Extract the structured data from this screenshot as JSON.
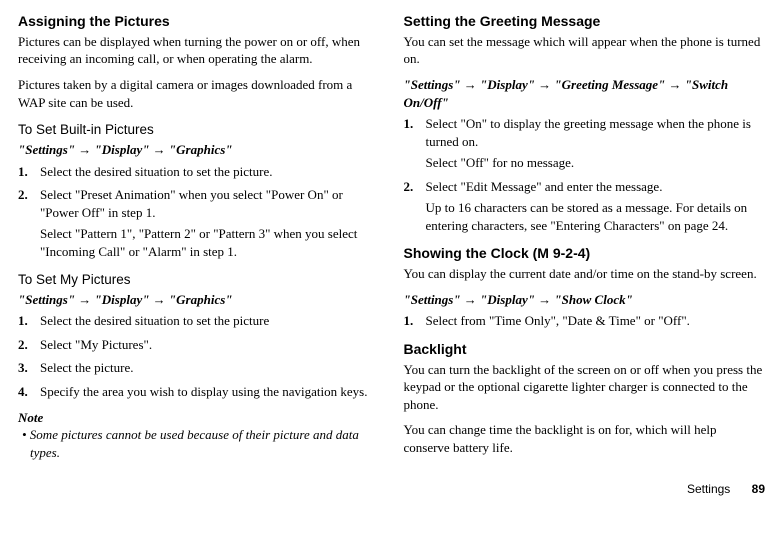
{
  "left": {
    "h1": "Assigning the Pictures",
    "p1": "Pictures can be displayed when turning the power on or off, when receiving an incoming call, or when operating the alarm.",
    "p2": "Pictures taken by a digital camera or images downloaded from a WAP site can be used.",
    "sub1": "To Set Built-in Pictures",
    "path1": "\"Settings\" → \"Display\" → \"Graphics\"",
    "s1_1": "Select the desired situation to set the picture.",
    "s1_2": "Select \"Preset Animation\" when you select \"Power On\" or \"Power Off\" in step 1.",
    "s1_2b": "Select \"Pattern 1\", \"Pattern 2\" or \"Pattern 3\" when you select \"Incoming Call\" or \"Alarm\" in step 1.",
    "sub2": "To Set My Pictures",
    "path2": "\"Settings\" → \"Display\" → \"Graphics\"",
    "s2_1": "Select the desired situation to set the picture",
    "s2_2": "Select \"My Pictures\".",
    "s2_3": "Select the picture.",
    "s2_4": "Specify the area you wish to display using the navigation keys.",
    "note_head": "Note",
    "note_body": "• Some pictures cannot be used because of their picture and data types."
  },
  "right": {
    "h1": "Setting the Greeting Message",
    "p1": "You can set the message which will appear when the phone is turned on.",
    "path1": "\"Settings\" → \"Display\" → \"Greeting Message\" → \"Switch On/Off\"",
    "s1_1": "Select \"On\" to display the greeting message when the phone is turned on.",
    "s1_1b": "Select \"Off\" for no message.",
    "s1_2": "Select \"Edit Message\" and enter the message.",
    "s1_2b": "Up to 16 characters can be stored as a message. For details on entering characters, see \"Entering Characters\" on page 24.",
    "h2": "Showing the Clock",
    "h2code": "(M 9-2-4)",
    "p2": "You can display the current date and/or time on the stand-by screen.",
    "path2": "\"Settings\" → \"Display\" → \"Show Clock\"",
    "s2_1": "Select from \"Time Only\", \"Date & Time\" or \"Off\".",
    "h3": "Backlight",
    "p3": "You can turn the backlight of the screen on or off when you press the keypad or the optional cigarette lighter charger is connected to the phone.",
    "p4": "You can change time the backlight is on for, which will help conserve battery life."
  },
  "footer": {
    "label": "Settings",
    "page": "89"
  }
}
